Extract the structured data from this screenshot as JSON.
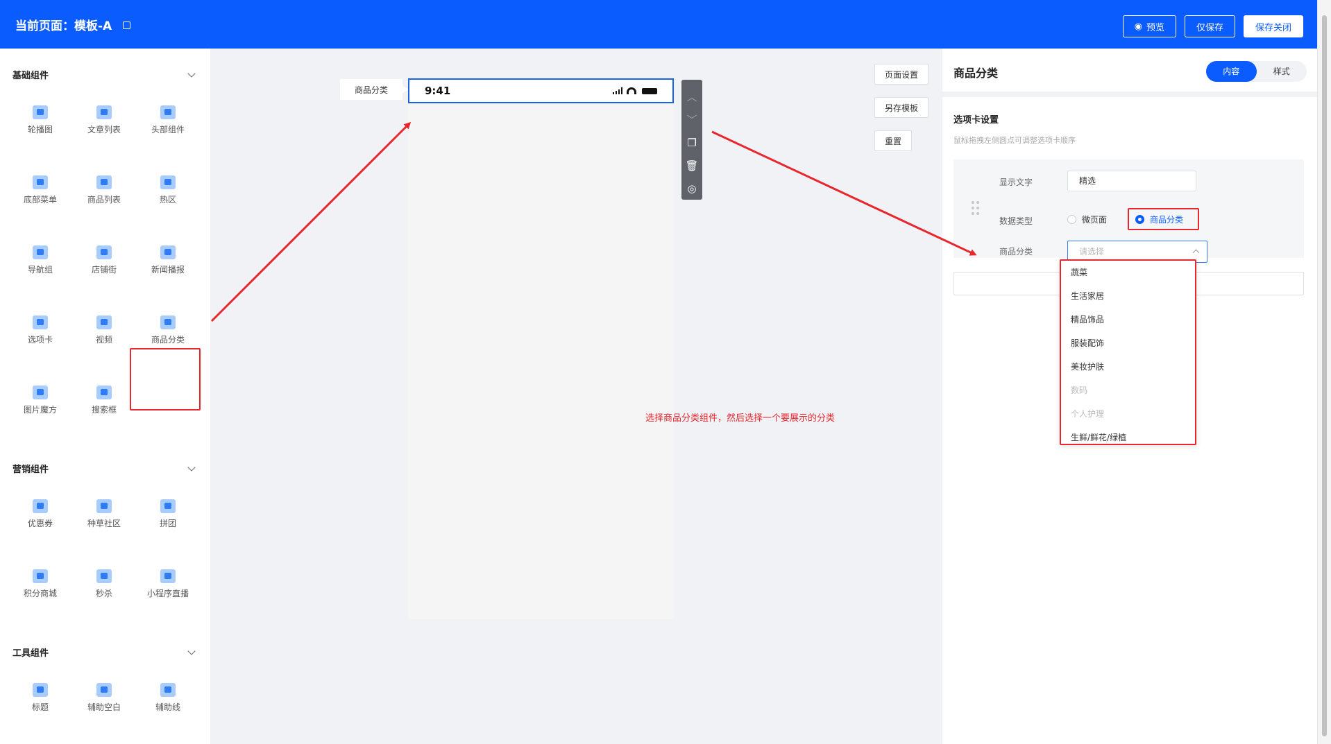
{
  "header": {
    "title": "当前页面：模板-A",
    "preview_label": "预览",
    "save_only_label": "仅保存",
    "save_close_label": "保存关闭"
  },
  "sidebar": {
    "sections": [
      {
        "title": "基础组件",
        "items": [
          {
            "label": "轮播图",
            "icon": "image-icon"
          },
          {
            "label": "文章列表",
            "icon": "article-list-icon"
          },
          {
            "label": "头部组件",
            "icon": "header-icon"
          },
          {
            "label": "底部菜单",
            "icon": "bottom-menu-icon"
          },
          {
            "label": "商品列表",
            "icon": "shopping-bag-icon"
          },
          {
            "label": "热区",
            "icon": "hotspot-icon"
          },
          {
            "label": "导航组",
            "icon": "navigation-icon"
          },
          {
            "label": "店铺街",
            "icon": "store-icon"
          },
          {
            "label": "新闻播报",
            "icon": "megaphone-icon"
          },
          {
            "label": "选项卡",
            "icon": "tabs-icon"
          },
          {
            "label": "视频",
            "icon": "video-icon"
          },
          {
            "label": "商品分类",
            "icon": "category-grid-icon"
          },
          {
            "label": "图片魔方",
            "icon": "image-cube-icon"
          },
          {
            "label": "搜索框",
            "icon": "search-icon"
          }
        ]
      },
      {
        "title": "营销组件",
        "items": [
          {
            "label": "优惠券",
            "icon": "coupon-icon"
          },
          {
            "label": "种草社区",
            "icon": "heart-icon"
          },
          {
            "label": "拼团",
            "icon": "group-buy-icon"
          },
          {
            "label": "积分商城",
            "icon": "points-mall-icon"
          },
          {
            "label": "秒杀",
            "icon": "flash-sale-icon"
          },
          {
            "label": "小程序直播",
            "icon": "live-camera-icon"
          }
        ]
      },
      {
        "title": "工具组件",
        "items": [
          {
            "label": "标题",
            "icon": "title-text-icon"
          },
          {
            "label": "辅助空白",
            "icon": "blank-space-icon"
          },
          {
            "label": "辅助线",
            "icon": "divider-line-icon"
          }
        ]
      }
    ]
  },
  "canvas": {
    "component_tag": "商品分类",
    "status_time": "9:41",
    "page_settings_label": "页面设置",
    "save_template_label": "另存模板",
    "reset_label": "重置",
    "annotation": "选择商品分类组件，然后选择一个要展示的分类"
  },
  "panel": {
    "title": "商品分类",
    "tabs": [
      "内容",
      "样式"
    ],
    "active_tab": "内容",
    "section_title": "选项卡设置",
    "hint": "鼠标拖拽左侧圆点可调整选项卡顺序",
    "display_text_label": "显示文字",
    "display_text_value": "精选",
    "data_type_label": "数据类型",
    "data_type_options": [
      "微页面",
      "商品分类"
    ],
    "data_type_selected": "商品分类",
    "category_label": "商品分类",
    "category_placeholder": "请选择",
    "category_options": [
      {
        "label": "蔬菜",
        "disabled": false
      },
      {
        "label": "生活家居",
        "disabled": false
      },
      {
        "label": "精品饰品",
        "disabled": false
      },
      {
        "label": "服装配饰",
        "disabled": false
      },
      {
        "label": "美妆护肤",
        "disabled": false
      },
      {
        "label": "数码",
        "disabled": true
      },
      {
        "label": "个人护理",
        "disabled": true
      },
      {
        "label": "生鲜/鲜花/绿植",
        "disabled": false
      }
    ]
  },
  "colors": {
    "primary": "#0a5cff",
    "highlight": "#e8262d"
  }
}
